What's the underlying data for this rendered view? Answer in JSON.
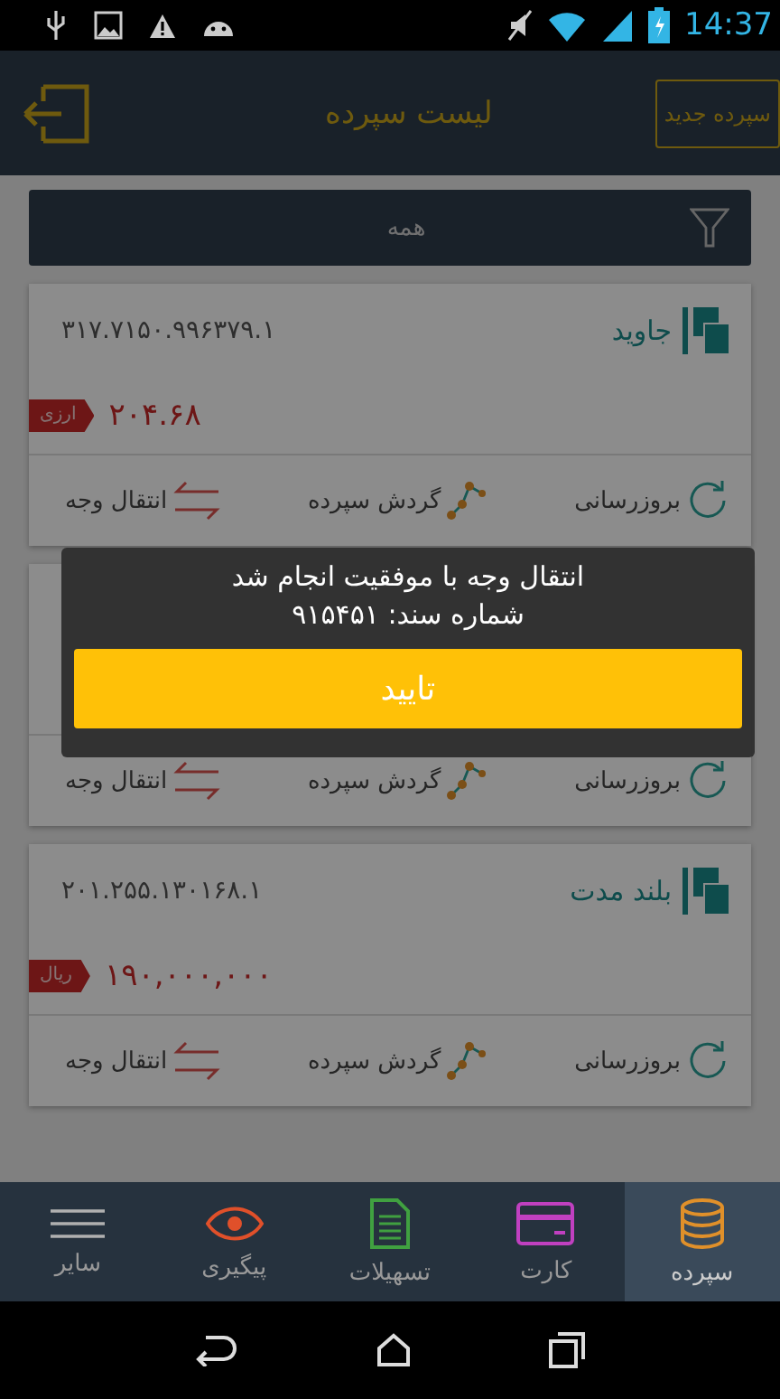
{
  "status_bar": {
    "time": "14:37"
  },
  "toolbar": {
    "title": "لیست سپرده",
    "new_button": "سپرده جدید"
  },
  "filter": {
    "value": "همه"
  },
  "cards": [
    {
      "name": "جاوید",
      "number": "۳۱۷.۷۱۵۰.۹۹۶۳۷۹.۱",
      "amount": "۲۰۴.۶۸",
      "currency": "ارزی",
      "actions": [
        "بروزرسانی",
        "گردش سپرده",
        "انتقال وجه"
      ]
    },
    {
      "actions": [
        "بروزرسانی",
        "گردش سپرده",
        "انتقال وجه"
      ]
    },
    {
      "name": "بلند مدت",
      "number": "۲۰۱.۲۵۵.۱۳۰۱۶۸.۱",
      "amount": "۱۹۰,۰۰۰,۰۰۰",
      "currency": "ریال",
      "actions": [
        "بروزرسانی",
        "گردش سپرده",
        "انتقال وجه"
      ]
    }
  ],
  "dialog": {
    "message": "انتقال وجه با موفقیت انجام شد",
    "document_number": "شماره سند: ۹۱۵۴۵۱",
    "button": "تایید"
  },
  "bottom_nav": [
    {
      "label": "سپرده",
      "kind": "coins",
      "color": "#e0902a",
      "selected": true
    },
    {
      "label": "کارت",
      "kind": "card",
      "color": "#c040c0",
      "selected": false
    },
    {
      "label": "تسهیلات",
      "kind": "document",
      "color": "#40a040",
      "selected": false
    },
    {
      "label": "پیگیری",
      "kind": "eye",
      "color": "#e0502a",
      "selected": false
    },
    {
      "label": "سایر",
      "kind": "menu",
      "color": "#b0b0b0",
      "selected": false
    }
  ]
}
